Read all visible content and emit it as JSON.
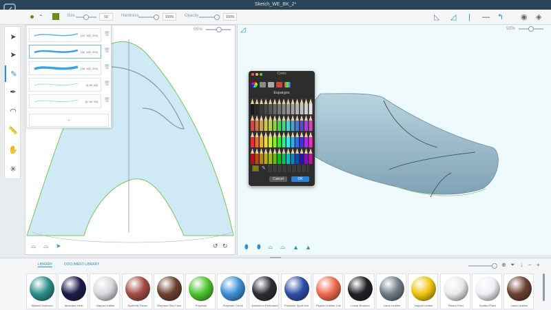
{
  "window": {
    "title": "Sketch_WE_BK_2*"
  },
  "topbar": {
    "size_label": "Size",
    "size_value": "50",
    "hardness_label": "Hardness",
    "hardness_value": "100%",
    "opacity_label": "Opacity",
    "opacity_value": "100%",
    "size_level": 0.5,
    "hardness_level": 1.0,
    "opacity_level": 1.0,
    "swatch_color": "#6d8a1c"
  },
  "brushes": [
    {
      "label": "(20, 100, 100)"
    },
    {
      "label": "(30, 100, 100)"
    },
    {
      "label": "(38, 100, 100)"
    },
    {
      "label": "(4.55, 60)"
    },
    {
      "label": "(8, 60, 99)"
    }
  ],
  "brush_add": "+",
  "canvas_left": {
    "zoom": "55%",
    "zoom_level": 0.55
  },
  "canvas_right": {
    "zoom": "50%",
    "zoom_level": 0.5
  },
  "color_dialog": {
    "title": "Cores",
    "selected_name": "Espargos",
    "cancel": "Cancel",
    "ok": "OK",
    "selected_color": "#808000"
  },
  "library": {
    "tab_library": "LIBRARY",
    "tab_document": "DOCUMENT LIBRARY",
    "materials": [
      {
        "name": "Stylized Diamond",
        "color": "#2a8f8a"
      },
      {
        "name": "Alcantara Helix",
        "color": "#1c1a4a"
      },
      {
        "name": "Nappa Leather",
        "color": "#d6d9dc"
      },
      {
        "name": "Synthetic Fabric",
        "color": "#a34b43"
      },
      {
        "name": "Elephant Skin Faux",
        "color": "#6e4030"
      },
      {
        "name": "Polyester",
        "color": "#4bc42b"
      },
      {
        "name": "Polyester Check",
        "color": "#3c90d8"
      },
      {
        "name": "Aluminium Perforated",
        "color": "#2a2d33"
      },
      {
        "name": "Polyester Sport Knit",
        "color": "#2f4fa8"
      },
      {
        "name": "Pigskin Leather Coll",
        "color": "#ef6a4c"
      },
      {
        "name": "Linear Brushed",
        "color": "#1e2024"
      },
      {
        "name": "Lamb Leather",
        "color": "#6f7b86"
      },
      {
        "name": "Nappa Leather",
        "color": "#f2c40f"
      },
      {
        "name": "Plaster Fixel",
        "color": "#e8eaec"
      },
      {
        "name": "Spotted Paint",
        "color": "#eeeff3"
      },
      {
        "name": "Lamb Leather",
        "color": "#6a3f30"
      }
    ]
  }
}
